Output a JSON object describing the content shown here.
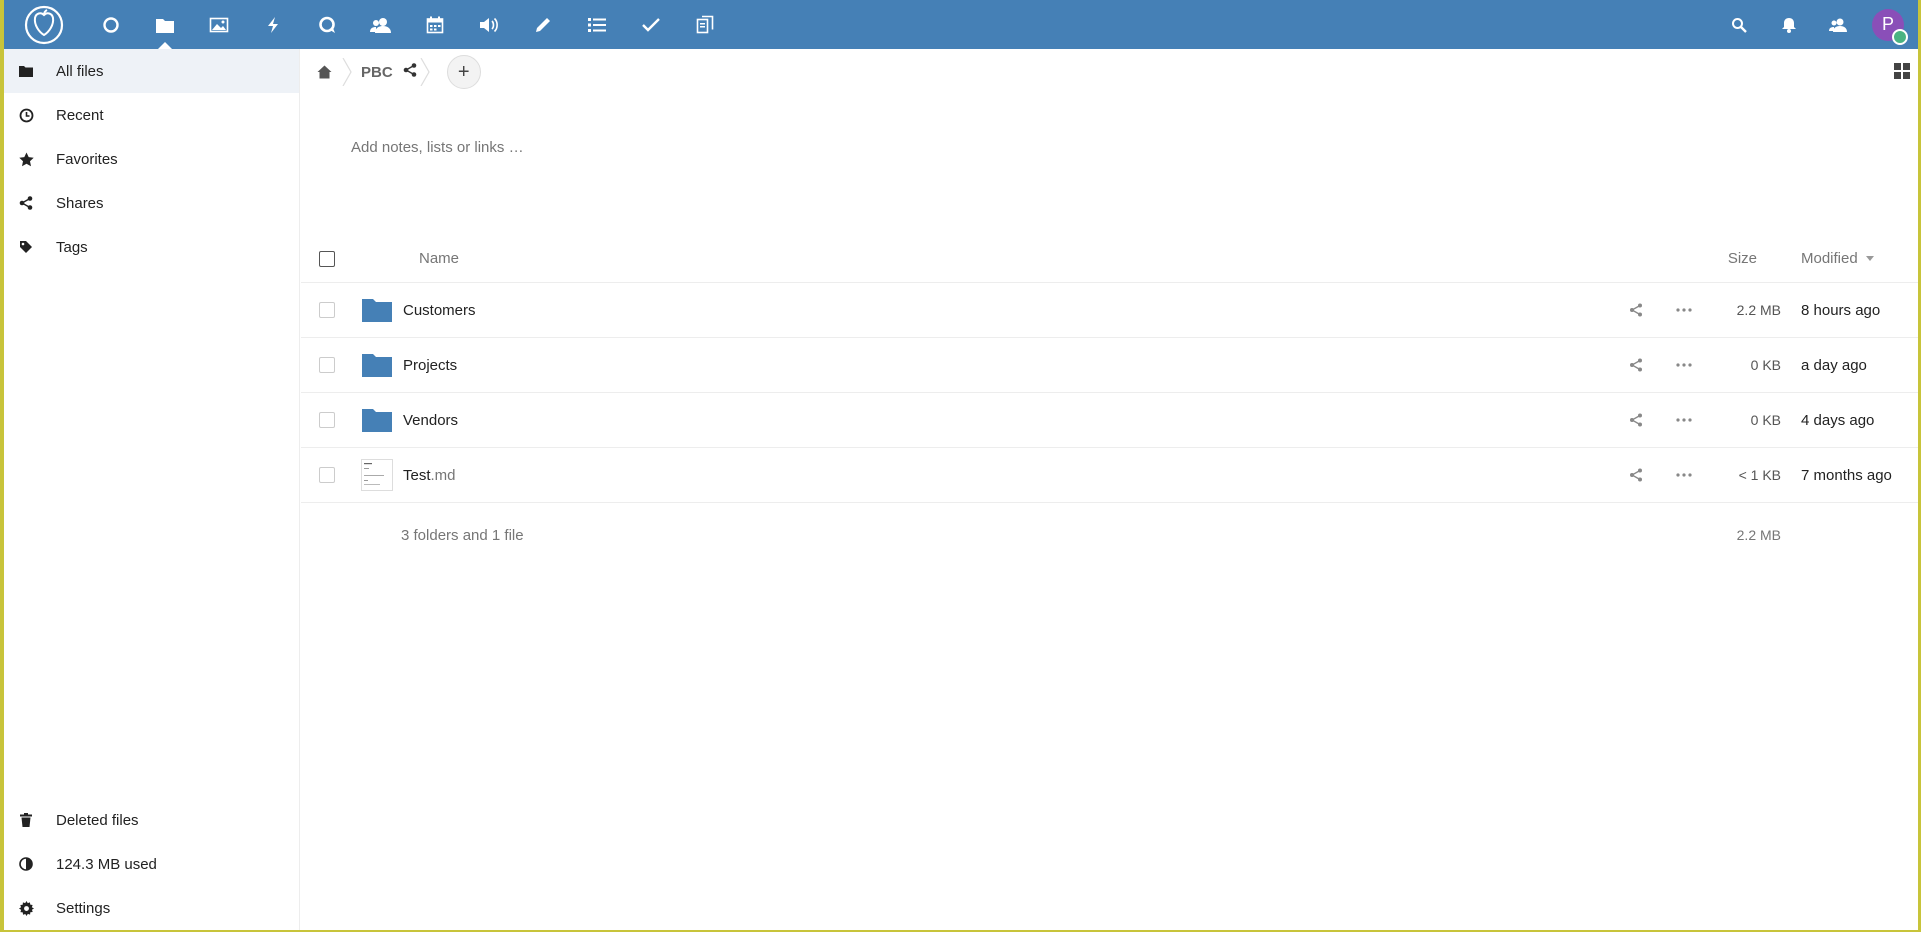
{
  "header": {
    "apps": [
      "dashboard",
      "files",
      "photos",
      "activity",
      "talk",
      "contacts",
      "calendar",
      "announcements",
      "notes",
      "deck",
      "tasks",
      "clipboard"
    ],
    "active_app": "files",
    "avatar_initial": "P",
    "colors": {
      "bar": "#4580b6",
      "avatar": "#8a4fb8",
      "status": "#49b382"
    }
  },
  "sidebar": {
    "items": [
      {
        "label": "All files",
        "icon": "folder-icon"
      },
      {
        "label": "Recent",
        "icon": "clock-icon"
      },
      {
        "label": "Favorites",
        "icon": "star-icon"
      },
      {
        "label": "Shares",
        "icon": "share-icon"
      },
      {
        "label": "Tags",
        "icon": "tag-icon"
      }
    ],
    "bottom": [
      {
        "label": "Deleted files",
        "icon": "trash-icon"
      },
      {
        "label": "124.3 MB used",
        "icon": "quota-icon"
      },
      {
        "label": "Settings",
        "icon": "gear-icon"
      }
    ]
  },
  "breadcrumb": {
    "current": "PBC"
  },
  "notes_placeholder": "Add notes, lists or links …",
  "table": {
    "columns": {
      "name": "Name",
      "size": "Size",
      "modified": "Modified"
    },
    "rows": [
      {
        "name": "Customers",
        "ext": "",
        "type": "folder",
        "size": "2.2 MB",
        "modified": "8 hours ago"
      },
      {
        "name": "Projects",
        "ext": "",
        "type": "folder",
        "size": "0 KB",
        "modified": "a day ago"
      },
      {
        "name": "Vendors",
        "ext": "",
        "type": "folder",
        "size": "0 KB",
        "modified": "4 days ago"
      },
      {
        "name": "Test",
        "ext": ".md",
        "type": "file",
        "size": "< 1 KB",
        "modified": "7 months ago"
      }
    ],
    "summary": {
      "text": "3 folders and 1 file",
      "size": "2.2 MB"
    }
  }
}
